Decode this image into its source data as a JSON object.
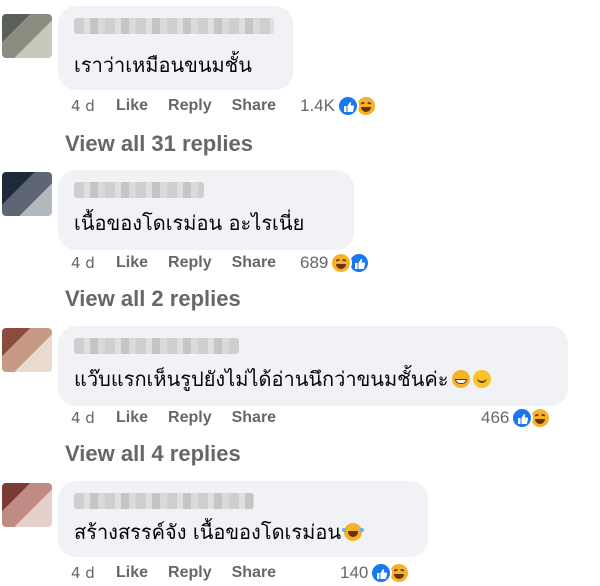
{
  "comments": [
    {
      "text": "เราว่าเหมือนขนมชั้น",
      "time": "4 d",
      "like_label": "Like",
      "reply_label": "Reply",
      "share_label": "Share",
      "reaction_count": "1.4K",
      "reactions": [
        "like-icon",
        "haha-icon"
      ],
      "view_replies": "View all 31 replies",
      "avatar_colors": [
        "#5b6158",
        "#8b8d80",
        "#c9c8bd"
      ]
    },
    {
      "text": "เนื้อของโดเรม่อน อะไรเนี่ย",
      "time": "4 d",
      "like_label": "Like",
      "reply_label": "Reply",
      "share_label": "Share",
      "reaction_count": "689",
      "reactions": [
        "haha-icon",
        "like-icon"
      ],
      "view_replies": "View all 2 replies",
      "avatar_colors": [
        "#1f2b3d",
        "#5e6676",
        "#b3b7be"
      ]
    },
    {
      "text": "แว๊บแรกเห็นรูปยังไม่ได้อ่านนึกว่าขนมชั้นค่ะ",
      "inline_emojis": [
        "grin-emoji",
        "smile-emoji"
      ],
      "time": "4 d",
      "like_label": "Like",
      "reply_label": "Reply",
      "share_label": "Share",
      "reaction_count": "466",
      "reactions": [
        "like-icon",
        "haha-icon"
      ],
      "view_replies": "View all 4 replies",
      "avatar_colors": [
        "#8a4c3e",
        "#c79a86",
        "#e9d9cf"
      ]
    },
    {
      "text": "สร้างสรรค์จัง เนื้อของโดเรม่อน",
      "inline_emojis": [
        "laugh-tears-emoji"
      ],
      "time": "4 d",
      "like_label": "Like",
      "reply_label": "Reply",
      "share_label": "Share",
      "reaction_count": "140",
      "reactions": [
        "like-icon",
        "haha-icon"
      ],
      "avatar_colors": [
        "#7b3b36",
        "#c08a85",
        "#e7cfcb"
      ]
    }
  ],
  "colors": {
    "bubble": "#f0f2f5",
    "secondary_text": "#65676b",
    "like_blue": "#1877f2",
    "haha_yellow": "#f7b125"
  }
}
